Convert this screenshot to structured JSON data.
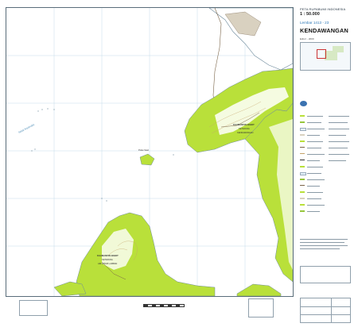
{
  "header": {
    "agency": "PETA RUPABUMI INDONESIA",
    "scale": "1 : 50.000",
    "sheet_number": "Lembar 1413 - 23",
    "sheet_name": "KENDAWANGAN",
    "edition": "Edisi I - 2000"
  },
  "map_labels": {
    "place_main": "KALIMANTAN BARAT",
    "regency": "KETAPANG",
    "district": "KENDAWANGAN",
    "place_south": "KALIMANTAN BARAT",
    "district_south": "KETAPANG",
    "subdistrict_south": "AIR HITAM LAMBAN",
    "sea": "Selat Karimata",
    "island": "Pulau Sawi"
  },
  "colors": {
    "land_green": "#b9e03a",
    "land_dark_green": "#96c63c",
    "land_white": "#ffffff",
    "water": "#e3f1f8",
    "contour": "#c4a36a",
    "grid": "#b7d3e4",
    "road": "#7a6448",
    "frame": "#5a6d7a",
    "title_blue": "#2d78b7"
  }
}
